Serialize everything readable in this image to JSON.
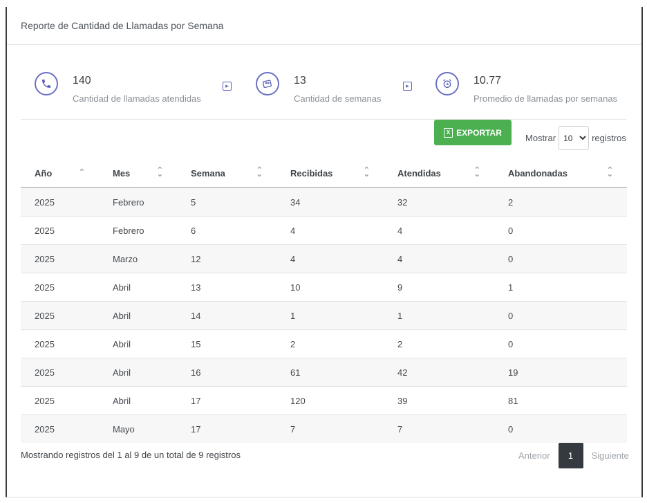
{
  "header": {
    "title": "Reporte de Cantidad de Llamadas por Semana"
  },
  "stats": [
    {
      "icon": "phone-icon",
      "value": "140",
      "label": "Cantidad de llamadas atendidas"
    },
    {
      "icon": "calendar-icon",
      "value": "13",
      "label": "Cantidad de semanas"
    },
    {
      "icon": "alarm-clock-icon",
      "value": "10.77",
      "label": "Promedio de llamadas por semanas"
    }
  ],
  "toolbar": {
    "export_label": "EXPORTAR",
    "show_label": "Mostrar",
    "page_size": "10",
    "records_label": "registros"
  },
  "table": {
    "columns": [
      "Año",
      "Mes",
      "Semana",
      "Recibidas",
      "Atendidas",
      "Abandonadas"
    ],
    "rows": [
      [
        "2025",
        "Febrero",
        "5",
        "34",
        "32",
        "2"
      ],
      [
        "2025",
        "Febrero",
        "6",
        "4",
        "4",
        "0"
      ],
      [
        "2025",
        "Marzo",
        "12",
        "4",
        "4",
        "0"
      ],
      [
        "2025",
        "Abril",
        "13",
        "10",
        "9",
        "1"
      ],
      [
        "2025",
        "Abril",
        "14",
        "1",
        "1",
        "0"
      ],
      [
        "2025",
        "Abril",
        "15",
        "2",
        "2",
        "0"
      ],
      [
        "2025",
        "Abril",
        "16",
        "61",
        "42",
        "19"
      ],
      [
        "2025",
        "Abril",
        "17",
        "120",
        "39",
        "81"
      ],
      [
        "2025",
        "Mayo",
        "17",
        "7",
        "7",
        "0"
      ]
    ]
  },
  "footer": {
    "info": "Mostrando registros del 1 al 9 de un total de 9 registros",
    "previous": "Anterior",
    "current_page": "1",
    "next": "Siguiente"
  },
  "colors": {
    "accent": "#6a6fc1",
    "export": "#4caf50",
    "pager_active": "#343a40"
  }
}
